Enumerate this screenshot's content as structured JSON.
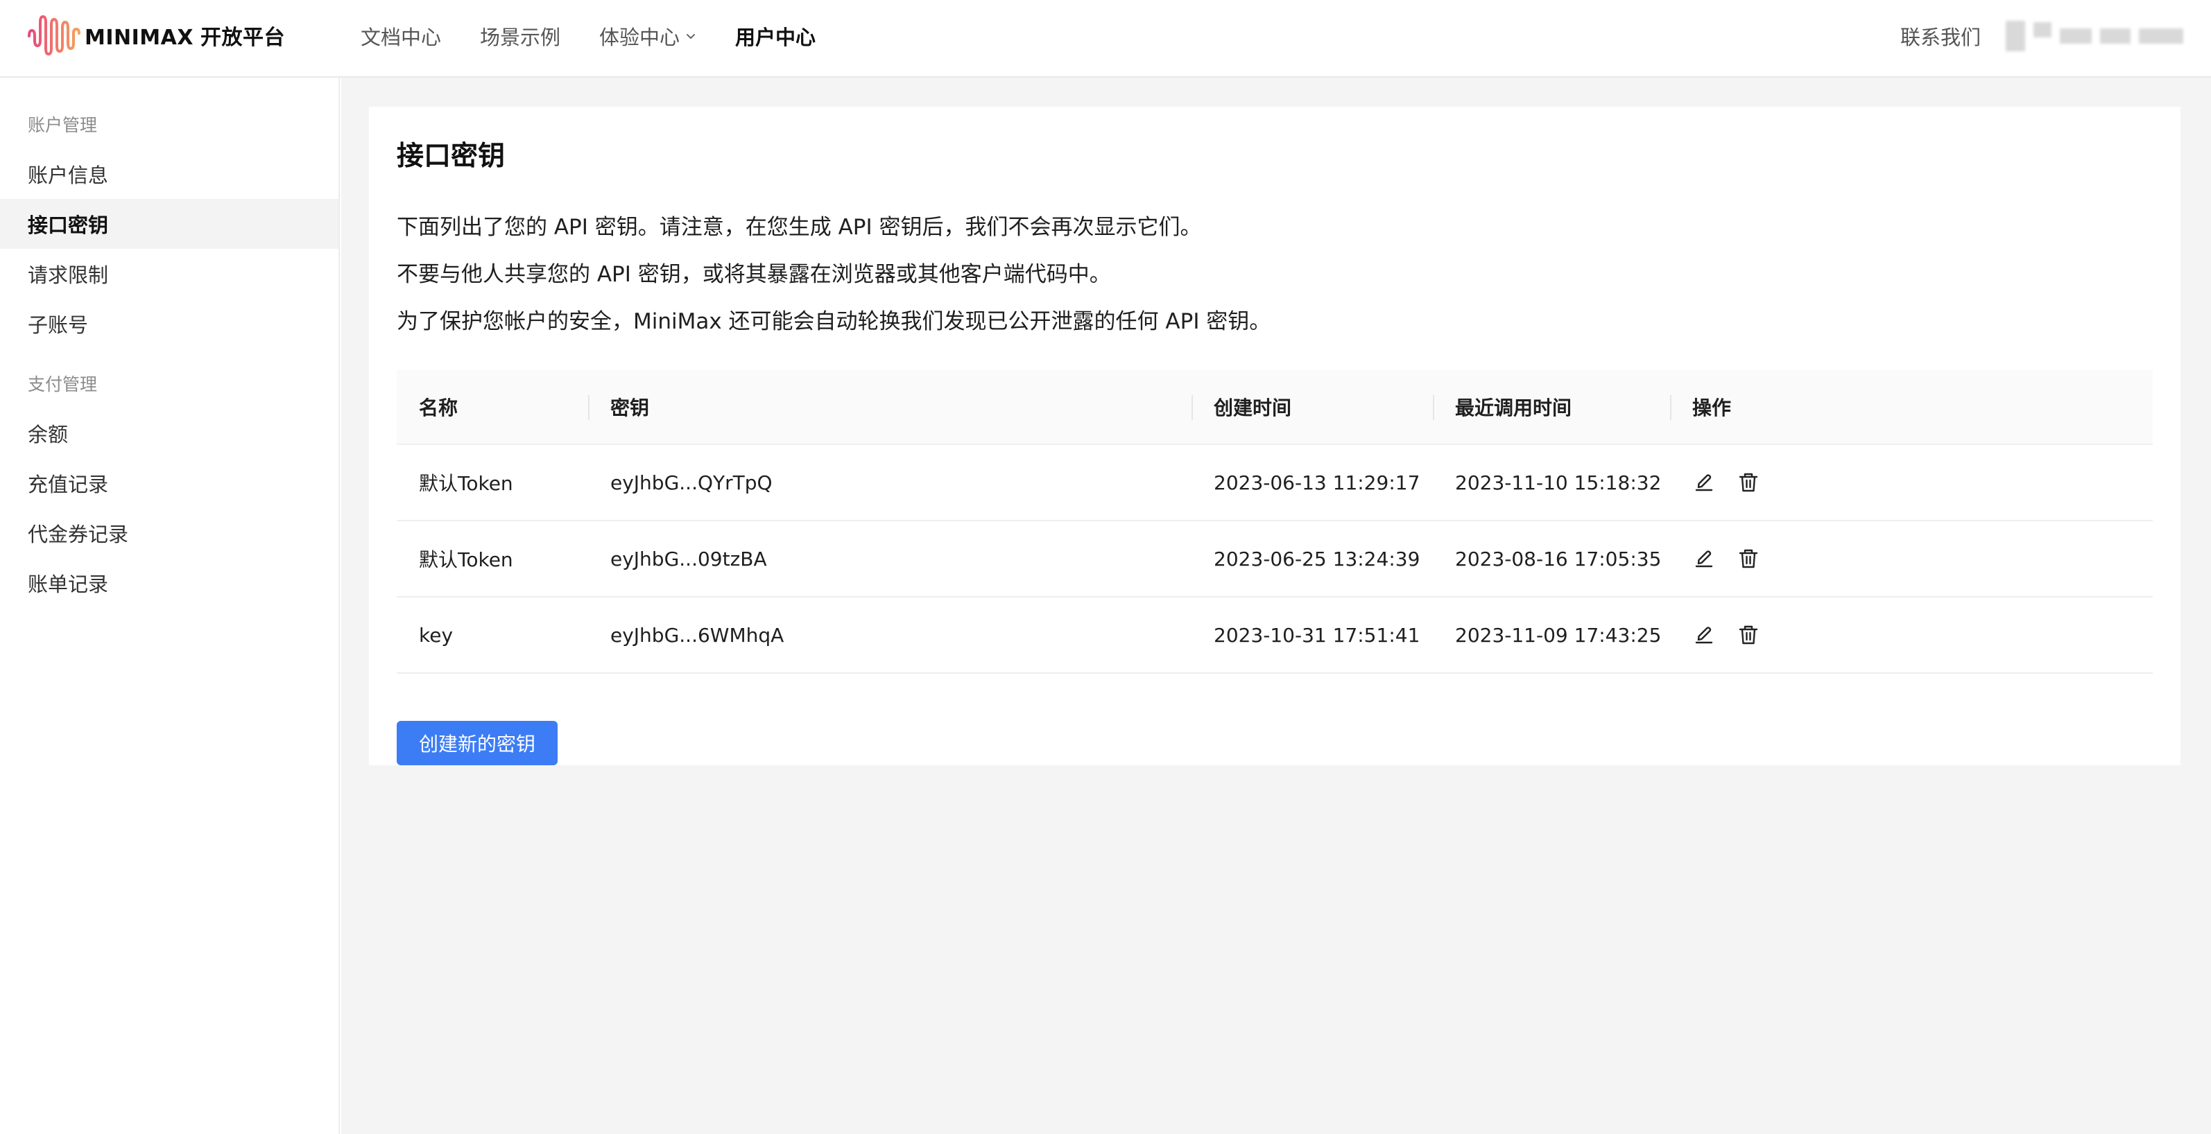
{
  "header": {
    "logo_text": "MINIMAX",
    "logo_sub": "开放平台",
    "nav": [
      {
        "label": "文档中心"
      },
      {
        "label": "场景示例"
      },
      {
        "label": "体验中心"
      },
      {
        "label": "用户中心"
      }
    ],
    "contact": "联系我们"
  },
  "sidebar": {
    "groups": [
      {
        "title": "账户管理",
        "items": [
          "账户信息",
          "接口密钥",
          "请求限制",
          "子账号"
        ]
      },
      {
        "title": "支付管理",
        "items": [
          "余额",
          "充值记录",
          "代金券记录",
          "账单记录"
        ]
      }
    ]
  },
  "main": {
    "title": "接口密钥",
    "desc": [
      "下面列出了您的 API 密钥。请注意，在您生成 API 密钥后，我们不会再次显示它们。",
      "不要与他人共享您的 API 密钥，或将其暴露在浏览器或其他客户端代码中。",
      "为了保护您帐户的安全，MiniMax 还可能会自动轮换我们发现已公开泄露的任何 API 密钥。"
    ],
    "table": {
      "headers": [
        "名称",
        "密钥",
        "创建时间",
        "最近调用时间",
        "操作"
      ],
      "rows": [
        {
          "name": "默认Token",
          "key": "eyJhbG...QYrTpQ",
          "created": "2023-06-13 11:29:17",
          "last_used": "2023-11-10 15:18:32"
        },
        {
          "name": "默认Token",
          "key": "eyJhbG...09tzBA",
          "created": "2023-06-25 13:24:39",
          "last_used": "2023-08-16 17:05:35"
        },
        {
          "name": "key",
          "key": "eyJhbG...6WMhqA",
          "created": "2023-10-31 17:51:41",
          "last_used": "2023-11-09 17:43:25"
        }
      ]
    },
    "create_button": "创建新的密钥"
  },
  "icons": {
    "edit": "pencil-icon",
    "delete": "trash-icon",
    "nav_dropdown": "chevron-down-icon",
    "logo": "soundwave-logo-icon"
  },
  "colors": {
    "accent": "#3c7cf5",
    "logo_gradient_start": "#e8467c",
    "logo_gradient_end": "#f7a258"
  }
}
